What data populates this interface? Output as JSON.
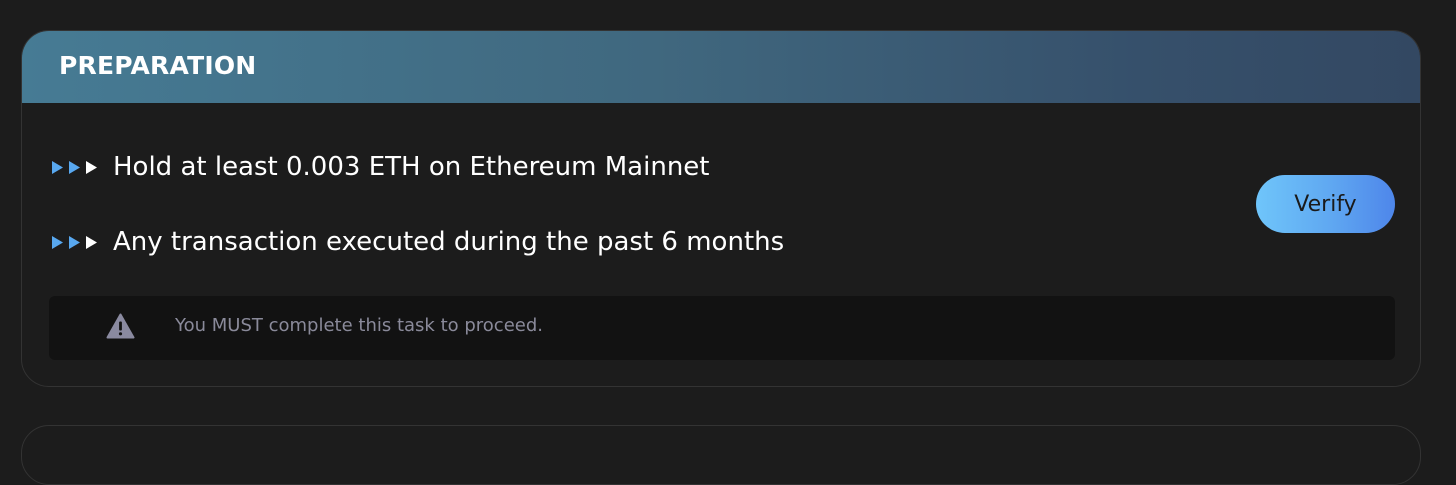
{
  "card": {
    "title": "PREPARATION",
    "requirements": [
      {
        "text": "Hold at least 0.003 ETH on Ethereum Mainnet",
        "icon": "triple-arrow-icon"
      },
      {
        "text": "Any transaction executed during the past 6 months",
        "icon": "triple-arrow-icon"
      }
    ],
    "verify_label": "Verify",
    "notice": {
      "icon": "warning-icon",
      "text": "You MUST complete this task to proceed."
    }
  },
  "colors": {
    "background": "#1c1c1c",
    "header_gradient_start": "#467b94",
    "header_gradient_end": "#334862",
    "arrow_blue": "#58a8f0",
    "button_gradient_start": "#6fc5fa",
    "button_gradient_end": "#4e86ea",
    "notice_background": "#121212",
    "notice_text": "#8a8a9a"
  }
}
